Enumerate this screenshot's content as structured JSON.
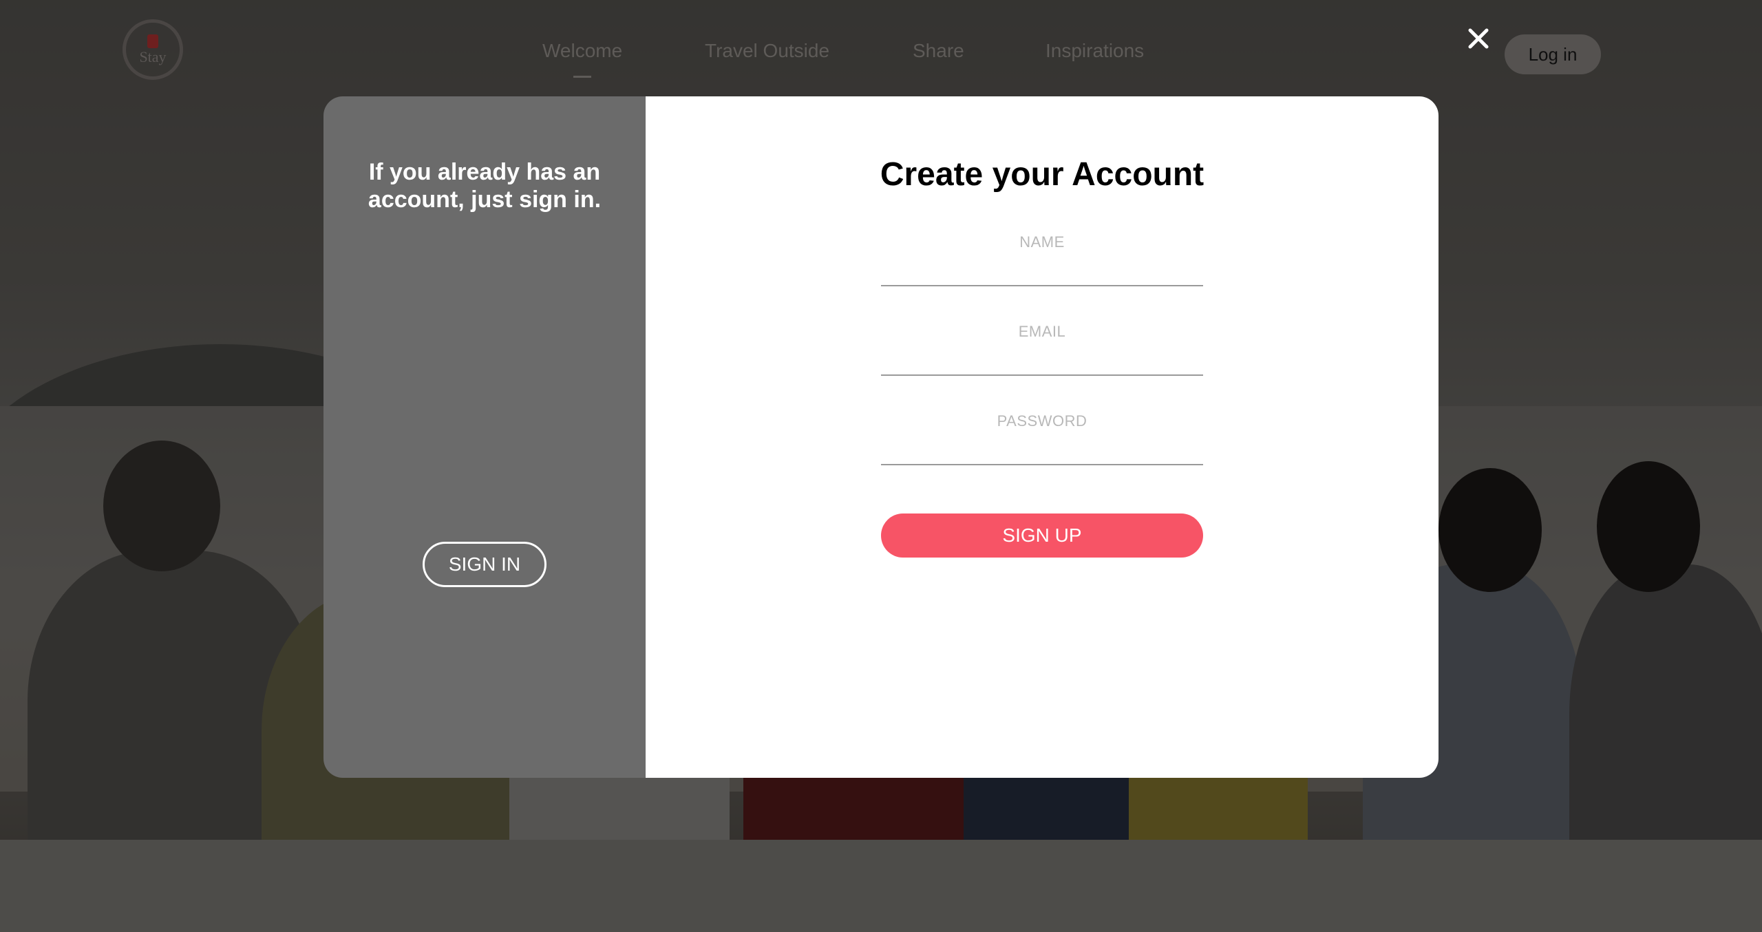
{
  "brand": {
    "logo_text": "Stay"
  },
  "nav": {
    "items": [
      {
        "label": "Welcome",
        "active": true
      },
      {
        "label": "Travel Outside",
        "active": false
      },
      {
        "label": "Share",
        "active": false
      },
      {
        "label": "Inspirations",
        "active": false
      }
    ],
    "close_icon": "close-icon",
    "login_label": "Log in"
  },
  "modal": {
    "left": {
      "prompt": "If you already has an account, just sign in.",
      "signin_label": "SIGN IN"
    },
    "right": {
      "title": "Create your Account",
      "fields": {
        "name_placeholder": "NAME",
        "email_placeholder": "EMAIL",
        "password_placeholder": "PASSWORD"
      },
      "signup_label": "SIGN UP"
    }
  },
  "colors": {
    "accent": "#f75466",
    "panel_left": "#6b6b6b",
    "panel_right": "#ffffff"
  }
}
